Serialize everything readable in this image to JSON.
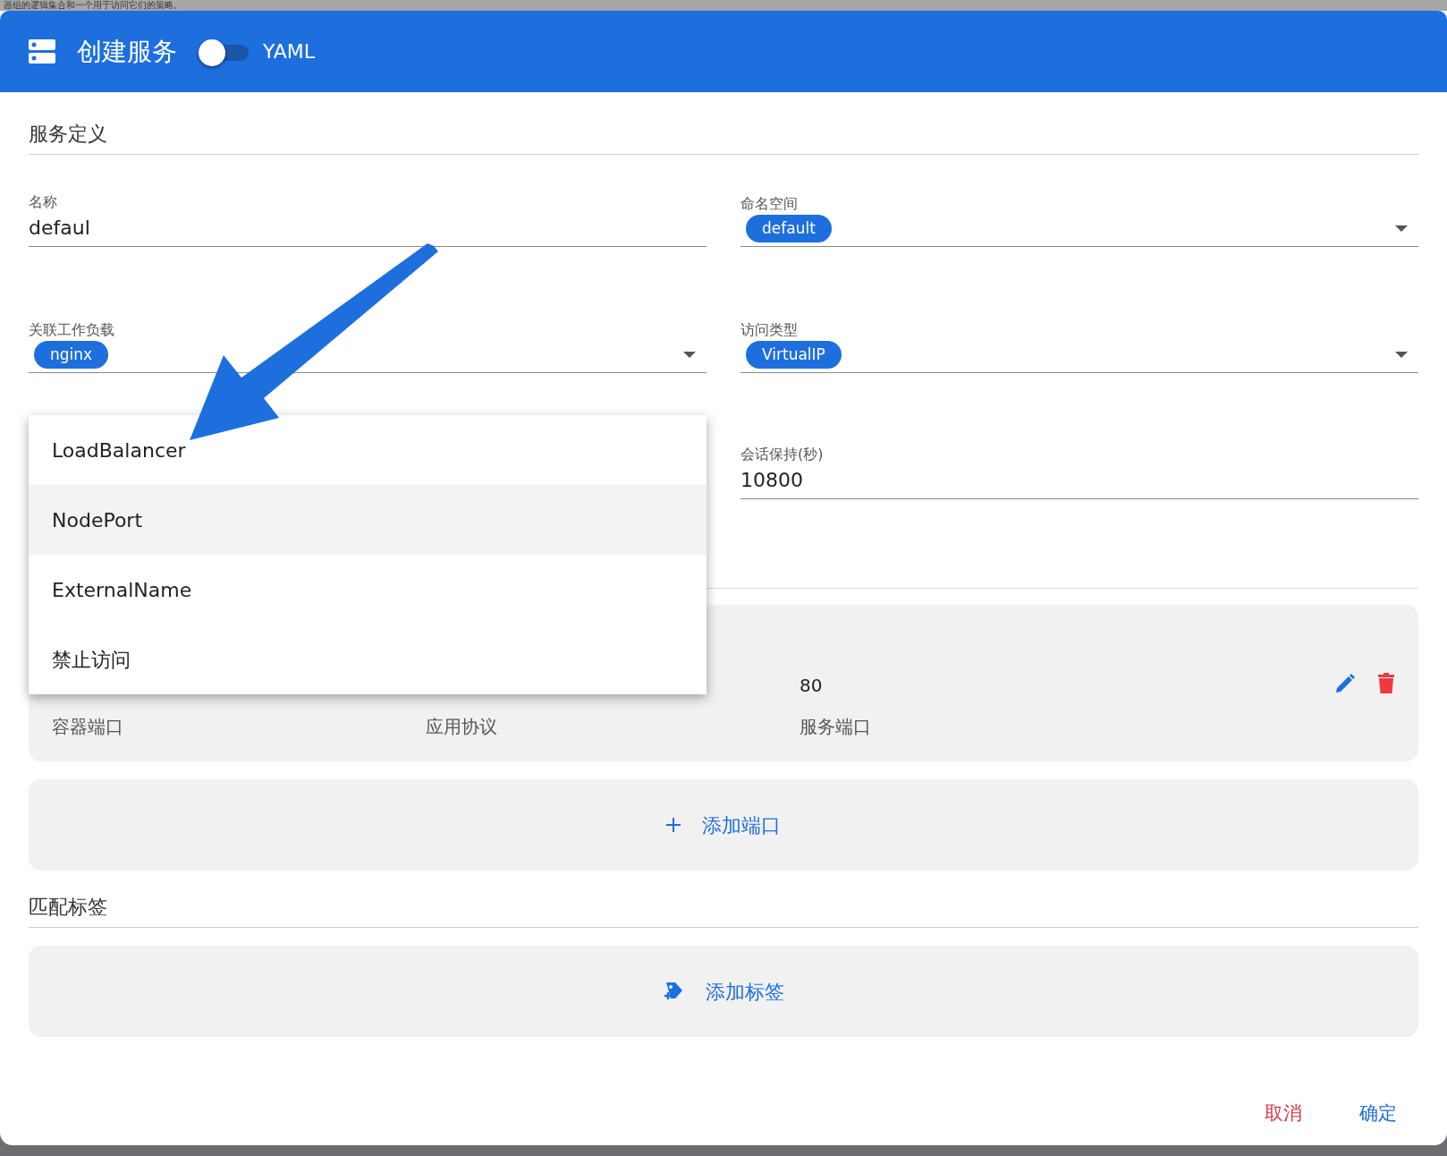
{
  "background_text": "器组的逻辑集合和一个用于访问它们的策略。",
  "header": {
    "title": "创建服务",
    "yaml_toggle": {
      "label": "YAML",
      "on": false
    }
  },
  "definition": {
    "title": "服务定义",
    "fields": [
      {
        "kind": "text",
        "label": "名称",
        "value": "defaul"
      },
      {
        "kind": "select",
        "label": "命名空间",
        "chips": [
          "default"
        ]
      },
      {
        "kind": "select",
        "label": "关联工作负载",
        "chips": [
          "nginx"
        ]
      },
      {
        "kind": "select",
        "label": "访问类型",
        "chips": [
          "VirtualIP"
        ]
      },
      {
        "kind": "empty"
      },
      {
        "kind": "text",
        "label": "会话保持(秒)",
        "value": "10800"
      }
    ]
  },
  "ports": {
    "rows": [
      {
        "service_port": "80",
        "labels": [
          "容器端口",
          "应用协议",
          "服务端口"
        ]
      }
    ],
    "add_label": "添加端口"
  },
  "labels_section": {
    "title": "匹配标签",
    "add_label": "添加标签"
  },
  "menu": {
    "items": [
      {
        "label": "LoadBalancer",
        "highlighted": false
      },
      {
        "label": "NodePort",
        "highlighted": true
      },
      {
        "label": "ExternalName",
        "highlighted": false
      },
      {
        "label": "禁止访问",
        "highlighted": false
      }
    ]
  },
  "footer": {
    "cancel": "取消",
    "confirm": "确定"
  }
}
